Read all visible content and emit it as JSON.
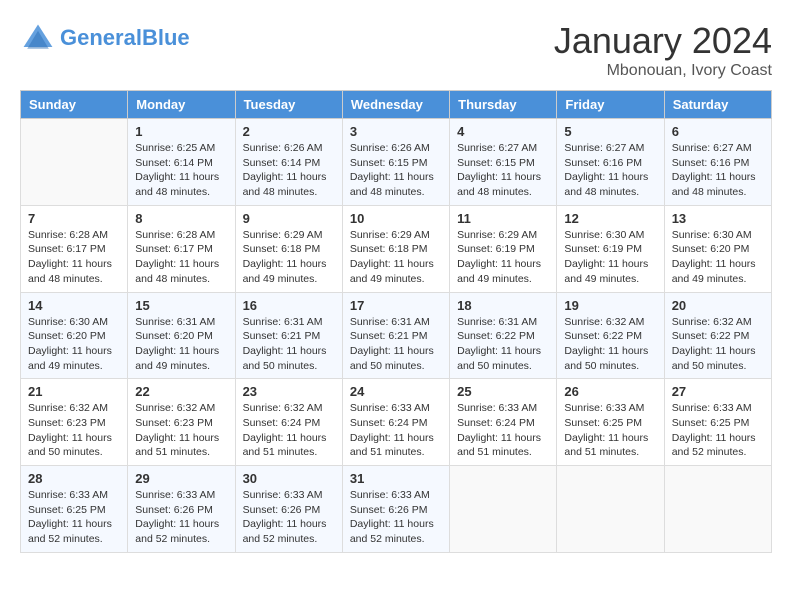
{
  "header": {
    "logo_line1": "General",
    "logo_line2": "Blue",
    "month": "January 2024",
    "location": "Mbonouan, Ivory Coast"
  },
  "days_of_week": [
    "Sunday",
    "Monday",
    "Tuesday",
    "Wednesday",
    "Thursday",
    "Friday",
    "Saturday"
  ],
  "weeks": [
    [
      {
        "day": "",
        "sunrise": "",
        "sunset": "",
        "daylight": ""
      },
      {
        "day": "1",
        "sunrise": "Sunrise: 6:25 AM",
        "sunset": "Sunset: 6:14 PM",
        "daylight": "Daylight: 11 hours and 48 minutes."
      },
      {
        "day": "2",
        "sunrise": "Sunrise: 6:26 AM",
        "sunset": "Sunset: 6:14 PM",
        "daylight": "Daylight: 11 hours and 48 minutes."
      },
      {
        "day": "3",
        "sunrise": "Sunrise: 6:26 AM",
        "sunset": "Sunset: 6:15 PM",
        "daylight": "Daylight: 11 hours and 48 minutes."
      },
      {
        "day": "4",
        "sunrise": "Sunrise: 6:27 AM",
        "sunset": "Sunset: 6:15 PM",
        "daylight": "Daylight: 11 hours and 48 minutes."
      },
      {
        "day": "5",
        "sunrise": "Sunrise: 6:27 AM",
        "sunset": "Sunset: 6:16 PM",
        "daylight": "Daylight: 11 hours and 48 minutes."
      },
      {
        "day": "6",
        "sunrise": "Sunrise: 6:27 AM",
        "sunset": "Sunset: 6:16 PM",
        "daylight": "Daylight: 11 hours and 48 minutes."
      }
    ],
    [
      {
        "day": "7",
        "sunrise": "Sunrise: 6:28 AM",
        "sunset": "Sunset: 6:17 PM",
        "daylight": "Daylight: 11 hours and 48 minutes."
      },
      {
        "day": "8",
        "sunrise": "Sunrise: 6:28 AM",
        "sunset": "Sunset: 6:17 PM",
        "daylight": "Daylight: 11 hours and 48 minutes."
      },
      {
        "day": "9",
        "sunrise": "Sunrise: 6:29 AM",
        "sunset": "Sunset: 6:18 PM",
        "daylight": "Daylight: 11 hours and 49 minutes."
      },
      {
        "day": "10",
        "sunrise": "Sunrise: 6:29 AM",
        "sunset": "Sunset: 6:18 PM",
        "daylight": "Daylight: 11 hours and 49 minutes."
      },
      {
        "day": "11",
        "sunrise": "Sunrise: 6:29 AM",
        "sunset": "Sunset: 6:19 PM",
        "daylight": "Daylight: 11 hours and 49 minutes."
      },
      {
        "day": "12",
        "sunrise": "Sunrise: 6:30 AM",
        "sunset": "Sunset: 6:19 PM",
        "daylight": "Daylight: 11 hours and 49 minutes."
      },
      {
        "day": "13",
        "sunrise": "Sunrise: 6:30 AM",
        "sunset": "Sunset: 6:20 PM",
        "daylight": "Daylight: 11 hours and 49 minutes."
      }
    ],
    [
      {
        "day": "14",
        "sunrise": "Sunrise: 6:30 AM",
        "sunset": "Sunset: 6:20 PM",
        "daylight": "Daylight: 11 hours and 49 minutes."
      },
      {
        "day": "15",
        "sunrise": "Sunrise: 6:31 AM",
        "sunset": "Sunset: 6:20 PM",
        "daylight": "Daylight: 11 hours and 49 minutes."
      },
      {
        "day": "16",
        "sunrise": "Sunrise: 6:31 AM",
        "sunset": "Sunset: 6:21 PM",
        "daylight": "Daylight: 11 hours and 50 minutes."
      },
      {
        "day": "17",
        "sunrise": "Sunrise: 6:31 AM",
        "sunset": "Sunset: 6:21 PM",
        "daylight": "Daylight: 11 hours and 50 minutes."
      },
      {
        "day": "18",
        "sunrise": "Sunrise: 6:31 AM",
        "sunset": "Sunset: 6:22 PM",
        "daylight": "Daylight: 11 hours and 50 minutes."
      },
      {
        "day": "19",
        "sunrise": "Sunrise: 6:32 AM",
        "sunset": "Sunset: 6:22 PM",
        "daylight": "Daylight: 11 hours and 50 minutes."
      },
      {
        "day": "20",
        "sunrise": "Sunrise: 6:32 AM",
        "sunset": "Sunset: 6:22 PM",
        "daylight": "Daylight: 11 hours and 50 minutes."
      }
    ],
    [
      {
        "day": "21",
        "sunrise": "Sunrise: 6:32 AM",
        "sunset": "Sunset: 6:23 PM",
        "daylight": "Daylight: 11 hours and 50 minutes."
      },
      {
        "day": "22",
        "sunrise": "Sunrise: 6:32 AM",
        "sunset": "Sunset: 6:23 PM",
        "daylight": "Daylight: 11 hours and 51 minutes."
      },
      {
        "day": "23",
        "sunrise": "Sunrise: 6:32 AM",
        "sunset": "Sunset: 6:24 PM",
        "daylight": "Daylight: 11 hours and 51 minutes."
      },
      {
        "day": "24",
        "sunrise": "Sunrise: 6:33 AM",
        "sunset": "Sunset: 6:24 PM",
        "daylight": "Daylight: 11 hours and 51 minutes."
      },
      {
        "day": "25",
        "sunrise": "Sunrise: 6:33 AM",
        "sunset": "Sunset: 6:24 PM",
        "daylight": "Daylight: 11 hours and 51 minutes."
      },
      {
        "day": "26",
        "sunrise": "Sunrise: 6:33 AM",
        "sunset": "Sunset: 6:25 PM",
        "daylight": "Daylight: 11 hours and 51 minutes."
      },
      {
        "day": "27",
        "sunrise": "Sunrise: 6:33 AM",
        "sunset": "Sunset: 6:25 PM",
        "daylight": "Daylight: 11 hours and 52 minutes."
      }
    ],
    [
      {
        "day": "28",
        "sunrise": "Sunrise: 6:33 AM",
        "sunset": "Sunset: 6:25 PM",
        "daylight": "Daylight: 11 hours and 52 minutes."
      },
      {
        "day": "29",
        "sunrise": "Sunrise: 6:33 AM",
        "sunset": "Sunset: 6:26 PM",
        "daylight": "Daylight: 11 hours and 52 minutes."
      },
      {
        "day": "30",
        "sunrise": "Sunrise: 6:33 AM",
        "sunset": "Sunset: 6:26 PM",
        "daylight": "Daylight: 11 hours and 52 minutes."
      },
      {
        "day": "31",
        "sunrise": "Sunrise: 6:33 AM",
        "sunset": "Sunset: 6:26 PM",
        "daylight": "Daylight: 11 hours and 52 minutes."
      },
      {
        "day": "",
        "sunrise": "",
        "sunset": "",
        "daylight": ""
      },
      {
        "day": "",
        "sunrise": "",
        "sunset": "",
        "daylight": ""
      },
      {
        "day": "",
        "sunrise": "",
        "sunset": "",
        "daylight": ""
      }
    ]
  ]
}
